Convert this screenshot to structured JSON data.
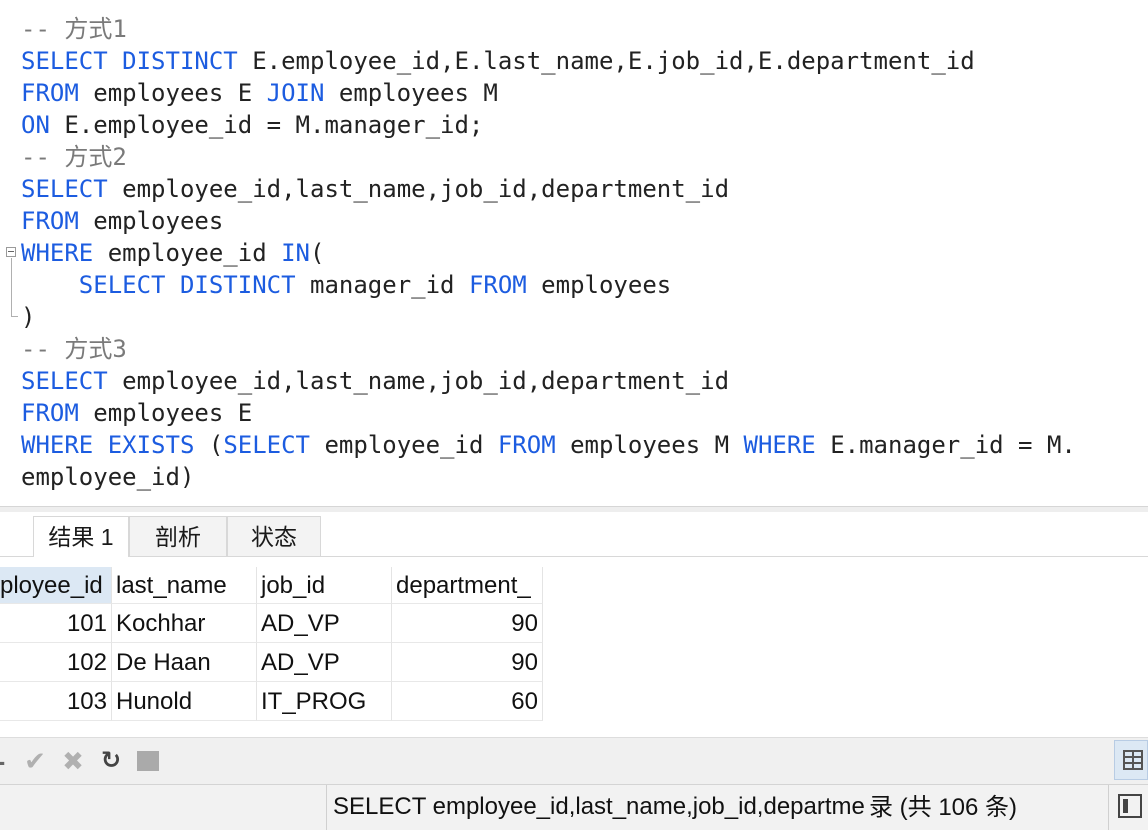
{
  "editor": {
    "lines": [
      {
        "tokens": [
          {
            "t": "-- 方式1",
            "c": "cm"
          }
        ]
      },
      {
        "tokens": [
          {
            "t": "SELECT",
            "c": "kw"
          },
          {
            "t": " ",
            "c": "tx"
          },
          {
            "t": "DISTINCT",
            "c": "kw"
          },
          {
            "t": " E.employee_id,E.last_name,E.job_id,E.department_id",
            "c": "tx"
          }
        ]
      },
      {
        "tokens": [
          {
            "t": "FROM",
            "c": "kw"
          },
          {
            "t": " employees E ",
            "c": "tx"
          },
          {
            "t": "JOIN",
            "c": "kw"
          },
          {
            "t": " employees M",
            "c": "tx"
          }
        ]
      },
      {
        "tokens": [
          {
            "t": "ON",
            "c": "kw"
          },
          {
            "t": " E.employee_id = M.manager_id;",
            "c": "tx"
          }
        ]
      },
      {
        "tokens": [
          {
            "t": "-- 方式2",
            "c": "cm"
          }
        ]
      },
      {
        "tokens": [
          {
            "t": "SELECT",
            "c": "kw"
          },
          {
            "t": " employee_id,last_name,job_id,department_id",
            "c": "tx"
          }
        ]
      },
      {
        "tokens": [
          {
            "t": "FROM",
            "c": "kw"
          },
          {
            "t": " employees",
            "c": "tx"
          }
        ]
      },
      {
        "tokens": [
          {
            "t": "WHERE",
            "c": "kw"
          },
          {
            "t": " employee_id ",
            "c": "tx"
          },
          {
            "t": "IN",
            "c": "kw"
          },
          {
            "t": "(",
            "c": "tx"
          }
        ]
      },
      {
        "tokens": [
          {
            "t": "    ",
            "c": "tx"
          },
          {
            "t": "SELECT",
            "c": "kw"
          },
          {
            "t": " ",
            "c": "tx"
          },
          {
            "t": "DISTINCT",
            "c": "kw"
          },
          {
            "t": " manager_id ",
            "c": "tx"
          },
          {
            "t": "FROM",
            "c": "kw"
          },
          {
            "t": " employees",
            "c": "tx"
          }
        ]
      },
      {
        "tokens": [
          {
            "t": ")",
            "c": "tx"
          }
        ]
      },
      {
        "tokens": [
          {
            "t": "-- 方式3",
            "c": "cm"
          }
        ]
      },
      {
        "tokens": [
          {
            "t": "SELECT",
            "c": "kw"
          },
          {
            "t": " employee_id,last_name,job_id,department_id",
            "c": "tx"
          }
        ]
      },
      {
        "tokens": [
          {
            "t": "FROM",
            "c": "kw"
          },
          {
            "t": " employees E",
            "c": "tx"
          }
        ]
      },
      {
        "tokens": [
          {
            "t": "WHERE",
            "c": "kw"
          },
          {
            "t": " ",
            "c": "tx"
          },
          {
            "t": "EXISTS",
            "c": "kw"
          },
          {
            "t": " (",
            "c": "tx"
          },
          {
            "t": "SELECT",
            "c": "kw"
          },
          {
            "t": " employee_id ",
            "c": "tx"
          },
          {
            "t": "FROM",
            "c": "kw"
          },
          {
            "t": " employees M ",
            "c": "tx"
          },
          {
            "t": "WHERE",
            "c": "kw"
          },
          {
            "t": " E.manager_id = M.",
            "c": "tx"
          }
        ]
      },
      {
        "tokens": [
          {
            "t": "employee_id)",
            "c": "tx"
          }
        ]
      }
    ]
  },
  "colors": {
    "keyword": "#1c5ce0",
    "comment": "#7a7a7a",
    "text": "#222222",
    "header_selected": "#dce8f4"
  },
  "tabs": [
    {
      "label": "结果 1",
      "active": true
    },
    {
      "label": "剖析",
      "active": false
    },
    {
      "label": "状态",
      "active": false
    }
  ],
  "grid": {
    "columns": [
      "ployee_id",
      "last_name",
      "job_id",
      "department_"
    ],
    "rows": [
      [
        "101",
        "Kochhar",
        "AD_VP",
        "90"
      ],
      [
        "102",
        "De Haan",
        "AD_VP",
        "90"
      ],
      [
        "103",
        "Hunold",
        "IT_PROG",
        "60"
      ]
    ]
  },
  "toolbar": {
    "minus_icon": "minus-icon",
    "check_icon": "✔",
    "cancel_icon": "✖",
    "refresh_icon": "↻",
    "stop_icon": "stop-icon",
    "grid_view_icon": "grid-view-icon"
  },
  "status": {
    "query_text": "SELECT employee_id,last_name,job_id,departme",
    "record_count": "录 (共 106 条)"
  }
}
